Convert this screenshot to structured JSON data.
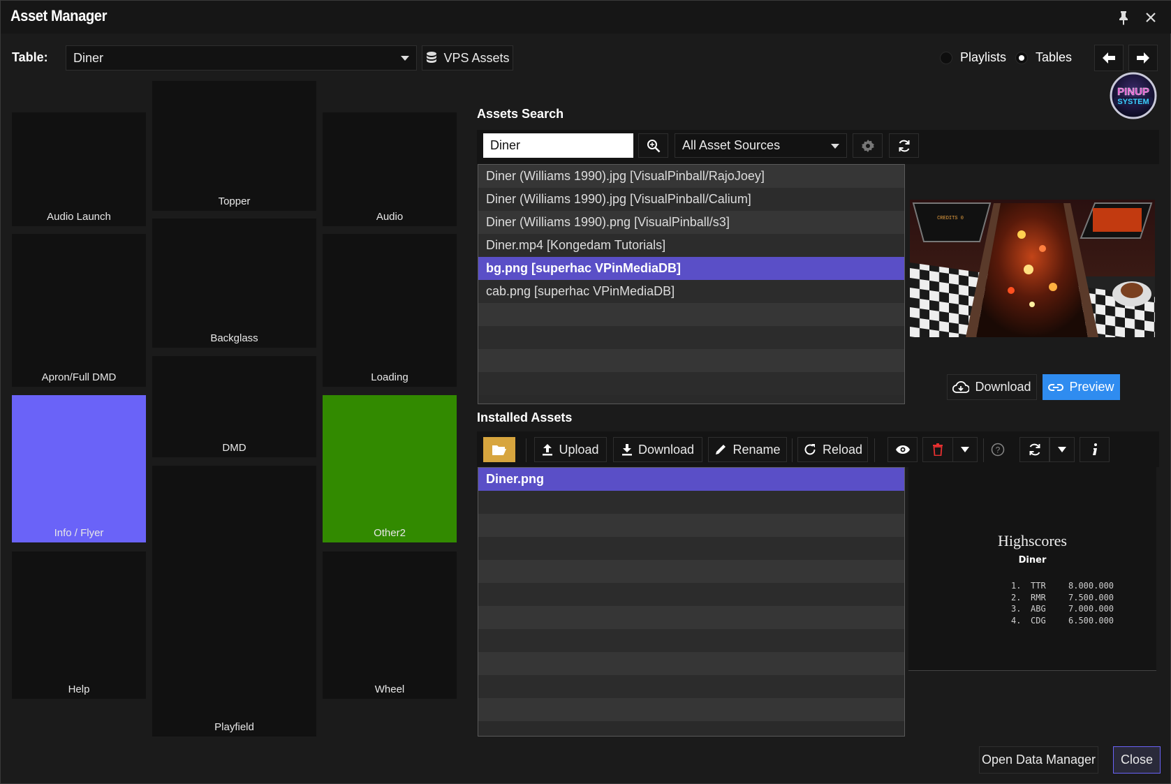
{
  "window": {
    "title": "Asset Manager"
  },
  "table_selector": {
    "label": "Table:",
    "value": "Diner",
    "vps_button": "VPS Assets"
  },
  "mode": {
    "playlists": "Playlists",
    "tables": "Tables",
    "selected": "Tables"
  },
  "screens": [
    {
      "label": "Audio Launch",
      "state": "normal"
    },
    {
      "label": "Topper",
      "state": "normal"
    },
    {
      "label": "Audio",
      "state": "normal"
    },
    {
      "label": "Apron/Full DMD",
      "state": "normal"
    },
    {
      "label": "Backglass",
      "state": "normal"
    },
    {
      "label": "Loading",
      "state": "normal"
    },
    {
      "label": "Info / Flyer",
      "state": "selected"
    },
    {
      "label": "DMD",
      "state": "normal"
    },
    {
      "label": "Other2",
      "state": "has-assets"
    },
    {
      "label": "Help",
      "state": "normal"
    },
    {
      "label": "Playfield",
      "state": "normal"
    },
    {
      "label": "Wheel",
      "state": "normal"
    }
  ],
  "assets_search": {
    "heading": "Assets Search",
    "query": "Diner",
    "source": "All Asset Sources",
    "results": [
      {
        "text": "Diner (Williams 1990).jpg  [VisualPinball/RajoJoey]",
        "selected": false
      },
      {
        "text": "Diner (Williams 1990).jpg  [VisualPinball/Calium]",
        "selected": false
      },
      {
        "text": "Diner (Williams 1990).png  [VisualPinball/s3]",
        "selected": false
      },
      {
        "text": "Diner.mp4  [Kongedam Tutorials]",
        "selected": false
      },
      {
        "text": "bg.png  [superhac VPinMediaDB]",
        "selected": true
      },
      {
        "text": "cab.png  [superhac VPinMediaDB]",
        "selected": false
      },
      {
        "text": "",
        "selected": false
      },
      {
        "text": "",
        "selected": false
      },
      {
        "text": "",
        "selected": false
      },
      {
        "text": "",
        "selected": false
      }
    ],
    "download_button": "Download",
    "preview_button": "Preview"
  },
  "installed_assets": {
    "heading": "Installed Assets",
    "toolbar": {
      "upload": "Upload",
      "download": "Download",
      "rename": "Rename",
      "reload": "Reload"
    },
    "files": [
      {
        "text": "Diner.png",
        "selected": true
      },
      {
        "text": "",
        "selected": false
      },
      {
        "text": "",
        "selected": false
      },
      {
        "text": "",
        "selected": false
      },
      {
        "text": "",
        "selected": false
      },
      {
        "text": "",
        "selected": false
      },
      {
        "text": "",
        "selected": false
      },
      {
        "text": "",
        "selected": false
      },
      {
        "text": "",
        "selected": false
      },
      {
        "text": "",
        "selected": false
      },
      {
        "text": "",
        "selected": false
      }
    ],
    "preview": {
      "title": "Highscores",
      "subtitle": "Diner",
      "scores": [
        {
          "rank": "1.",
          "initials": "TTR",
          "score": "8.000.000"
        },
        {
          "rank": "2.",
          "initials": "RMR",
          "score": "7.500.000"
        },
        {
          "rank": "3.",
          "initials": "ABG",
          "score": "7.000.000"
        },
        {
          "rank": "4.",
          "initials": "CDG",
          "score": "6.500.000"
        }
      ]
    }
  },
  "footer": {
    "open_data_manager": "Open Data Manager",
    "close": "Close"
  },
  "colors": {
    "selection": "#5a4fc7",
    "tile_selected": "#6a63f8",
    "tile_has_assets": "#328a00",
    "accent_blue": "#2f8cf0",
    "folder_gold": "#d7a53e"
  },
  "logo": {
    "text": "PINUP SYSTEM"
  }
}
